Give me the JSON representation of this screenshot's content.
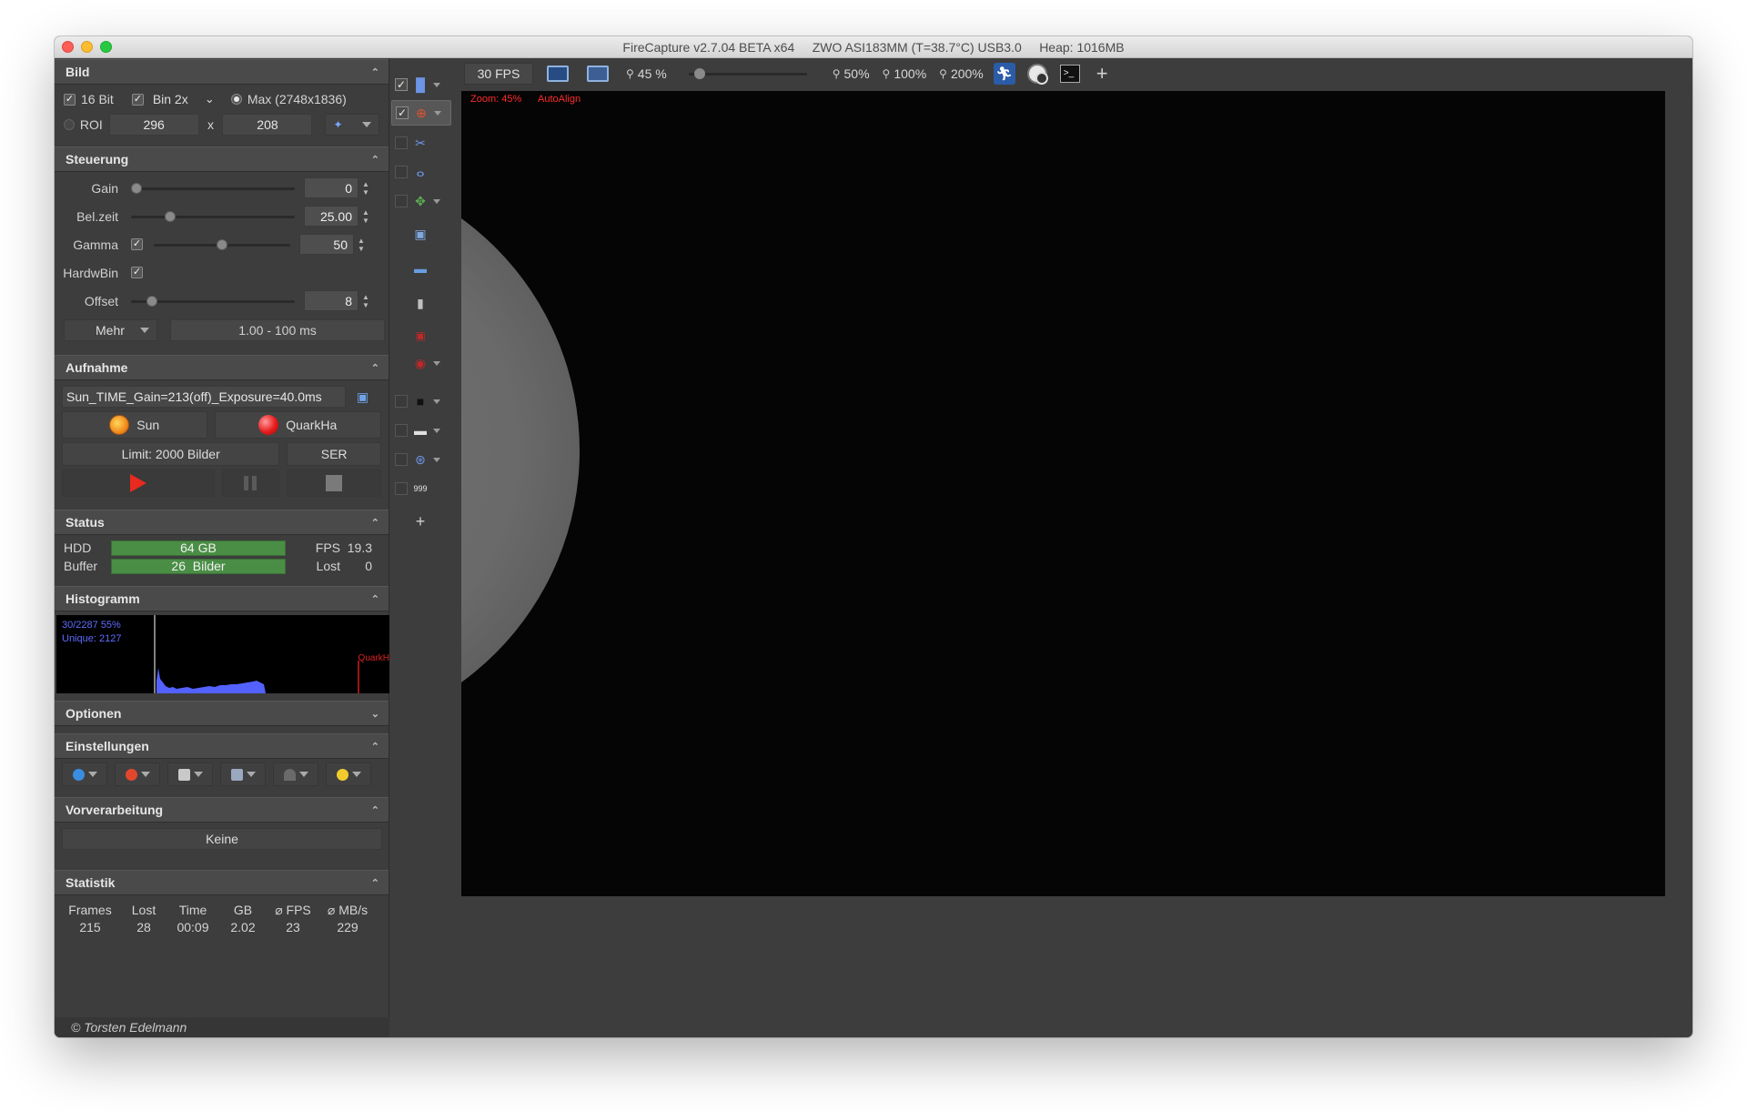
{
  "window": {
    "title": "FireCapture v2.7.04 BETA x64     ZWO ASI183MM (T=38.7°C) USB3.0     Heap: 1016MB"
  },
  "bild": {
    "header": "Bild",
    "bit16_label": "16 Bit",
    "bin_label": "Bin 2x",
    "max_label": "Max (2748x1836)",
    "roi_label": "ROI",
    "roi_w": "296",
    "roi_x": "x",
    "roi_h": "208"
  },
  "steuerung": {
    "header": "Steuerung",
    "gain_label": "Gain",
    "gain_value": "0",
    "gain_level": 0.0,
    "belzeit_label": "Bel.zeit",
    "belzeit_value": "25.00",
    "belzeit_level": 0.22,
    "gamma_label": "Gamma",
    "gamma_value": "50",
    "gamma_level": 0.5,
    "hardwbin_label": "HardwBin",
    "offset_label": "Offset",
    "offset_value": "8",
    "offset_level": 0.1,
    "mehr_label": "Mehr",
    "range_label": "1.00 - 100 ms"
  },
  "aufnahme": {
    "header": "Aufnahme",
    "filename": "Sun_TIME_Gain=213(off)_Exposure=40.0ms",
    "profile1": "Sun",
    "profile2": "QuarkHa",
    "limit_label": "Limit: 2000 Bilder",
    "format_label": "SER"
  },
  "status": {
    "header": "Status",
    "hdd_label": "HDD",
    "hdd_value": "64 GB",
    "buffer_label": "Buffer",
    "buffer_value": "26  Bilder",
    "fps_label": "FPS",
    "fps_value": "19.3",
    "lost_label": "Lost",
    "lost_value": "0"
  },
  "histogramm": {
    "header": "Histogramm",
    "line1": "30/2287 55%",
    "line2": "Unique: 2127",
    "marker_label": "QuarkH"
  },
  "optionen": {
    "header": "Optionen"
  },
  "einstellungen": {
    "header": "Einstellungen"
  },
  "vorverarbeitung": {
    "header": "Vorverarbeitung",
    "value": "Keine"
  },
  "statistik": {
    "header": "Statistik",
    "columns": [
      "Frames",
      "Lost",
      "Time",
      "GB",
      "⌀ FPS",
      "⌀ MB/s"
    ],
    "values": [
      "215",
      "28",
      "00:09",
      "2.02",
      "23",
      "229"
    ]
  },
  "copyright": "© Torsten Edelmann",
  "toolbar": {
    "fps": "30 FPS",
    "zoom_value": "45 %",
    "zoom50": "50%",
    "zoom100": "100%",
    "zoom200": "200%"
  },
  "viewer": {
    "zoom_label": "Zoom: 45%",
    "align_label": "AutoAlign"
  },
  "colors": {
    "panel_bg": "#3d3d3d",
    "status_bar_green": "#4a8e45",
    "overlay_red": "#ff2a2a",
    "histogram_blue": "#5f6cff"
  }
}
